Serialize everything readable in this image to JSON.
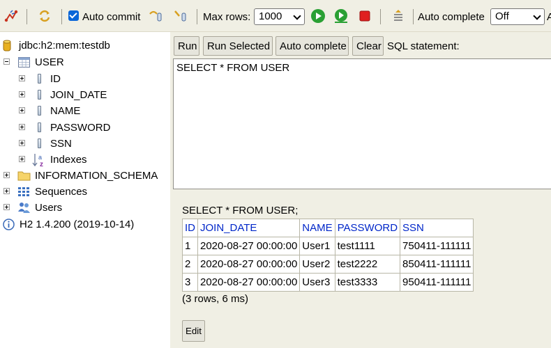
{
  "toolbar": {
    "auto_commit_label": "Auto commit",
    "max_rows_label": "Max rows:",
    "max_rows_value": "1000",
    "auto_complete_label": "Auto complete",
    "auto_complete_value": "Off",
    "cut_text": "A"
  },
  "tree": {
    "connection": "jdbc:h2:mem:testdb",
    "table": "USER",
    "columns": [
      "ID",
      "JOIN_DATE",
      "NAME",
      "PASSWORD",
      "SSN"
    ],
    "indexes": "Indexes",
    "schema": "INFORMATION_SCHEMA",
    "sequences": "Sequences",
    "users": "Users",
    "version": "H2 1.4.200 (2019-10-14)"
  },
  "buttons": {
    "run": "Run",
    "run_selected": "Run Selected",
    "auto_complete": "Auto complete",
    "clear": "Clear",
    "sql_statement_label": "SQL statement:"
  },
  "editor": {
    "text": "SELECT * FROM USER"
  },
  "result": {
    "sql": "SELECT * FROM USER;",
    "headers": [
      "ID",
      "JOIN_DATE",
      "NAME",
      "PASSWORD",
      "SSN"
    ],
    "rows": [
      [
        "1",
        "2020-08-27 00:00:00",
        "User1",
        "test1111",
        "750411-111111"
      ],
      [
        "2",
        "2020-08-27 00:00:00",
        "User2",
        "test2222",
        "850411-111111"
      ],
      [
        "3",
        "2020-08-27 00:00:00",
        "User3",
        "test3333",
        "950411-111111"
      ]
    ],
    "summary": "(3 rows, 6 ms)",
    "edit_label": "Edit"
  },
  "colors": {
    "panel_bg": "#f0efe4",
    "header_link": "#0026c9",
    "run_green": "#2aa034",
    "stop_red": "#e02020"
  }
}
